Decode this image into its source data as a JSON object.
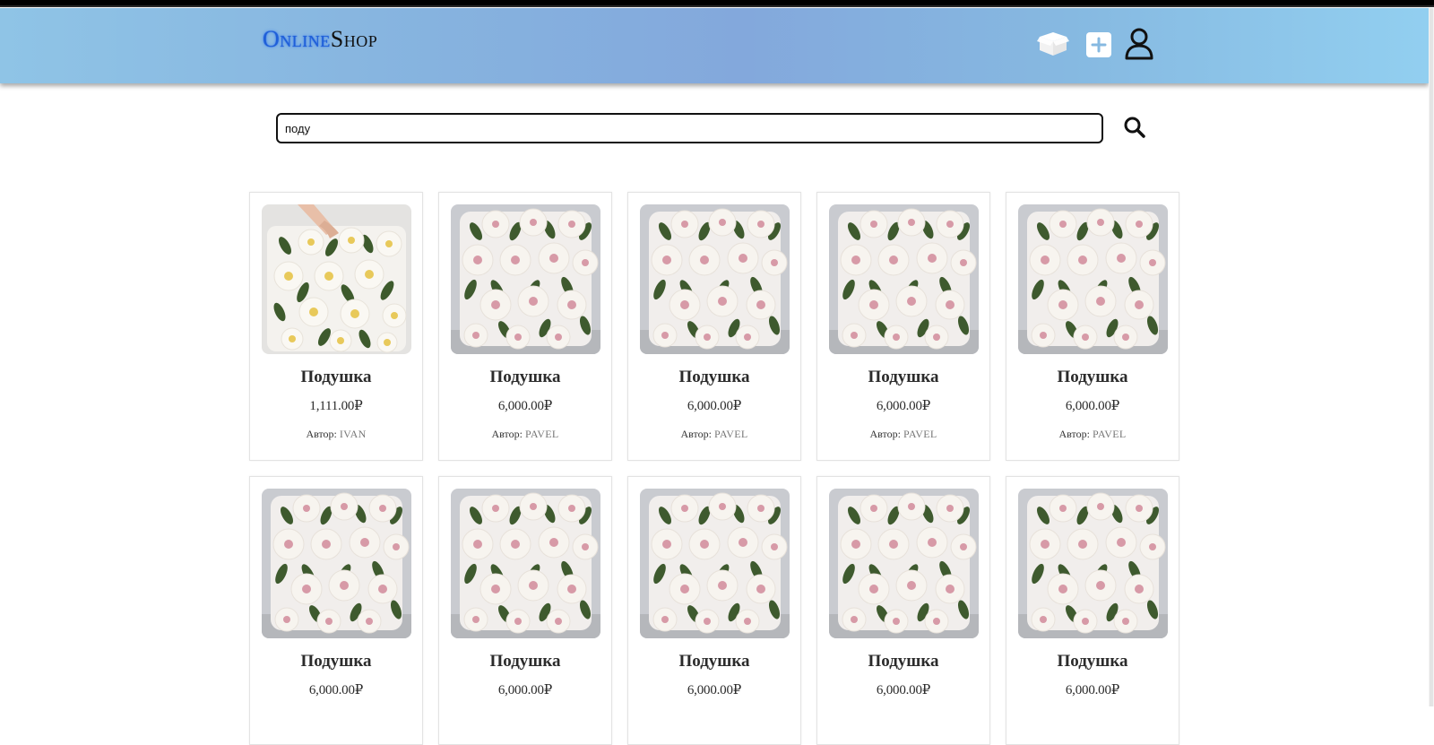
{
  "header": {
    "logo_part1": "Online",
    "logo_part2": "Shop"
  },
  "icons": {
    "orders": "box-icon",
    "add": "plus-icon",
    "profile": "user-icon",
    "search": "search-icon"
  },
  "search": {
    "value": "поду",
    "placeholder": ""
  },
  "colors": {
    "header_gradient_start": "#8fc4e6",
    "header_gradient_mid": "#83a8dc",
    "header_gradient_end": "#92cff0",
    "logo_accent": "#1f5fd8"
  },
  "products": [
    {
      "title": "Подушка",
      "price": "1,111.00₽",
      "author_label": "Автор:",
      "author": "IVAN",
      "image": "yellow-flower-pillow"
    },
    {
      "title": "Подушка",
      "price": "6,000.00₽",
      "author_label": "Автор:",
      "author": "PAVEL",
      "image": "pink-flower-pillow"
    },
    {
      "title": "Подушка",
      "price": "6,000.00₽",
      "author_label": "Автор:",
      "author": "PAVEL",
      "image": "pink-flower-pillow"
    },
    {
      "title": "Подушка",
      "price": "6,000.00₽",
      "author_label": "Автор:",
      "author": "PAVEL",
      "image": "pink-flower-pillow"
    },
    {
      "title": "Подушка",
      "price": "6,000.00₽",
      "author_label": "Автор:",
      "author": "PAVEL",
      "image": "pink-flower-pillow"
    },
    {
      "title": "Подушка",
      "price": "6,000.00₽",
      "image": "pink-flower-pillow"
    },
    {
      "title": "Подушка",
      "price": "6,000.00₽",
      "image": "pink-flower-pillow"
    },
    {
      "title": "Подушка",
      "price": "6,000.00₽",
      "image": "pink-flower-pillow"
    },
    {
      "title": "Подушка",
      "price": "6,000.00₽",
      "image": "pink-flower-pillow"
    },
    {
      "title": "Подушка",
      "price": "6,000.00₽",
      "image": "pink-flower-pillow"
    }
  ]
}
